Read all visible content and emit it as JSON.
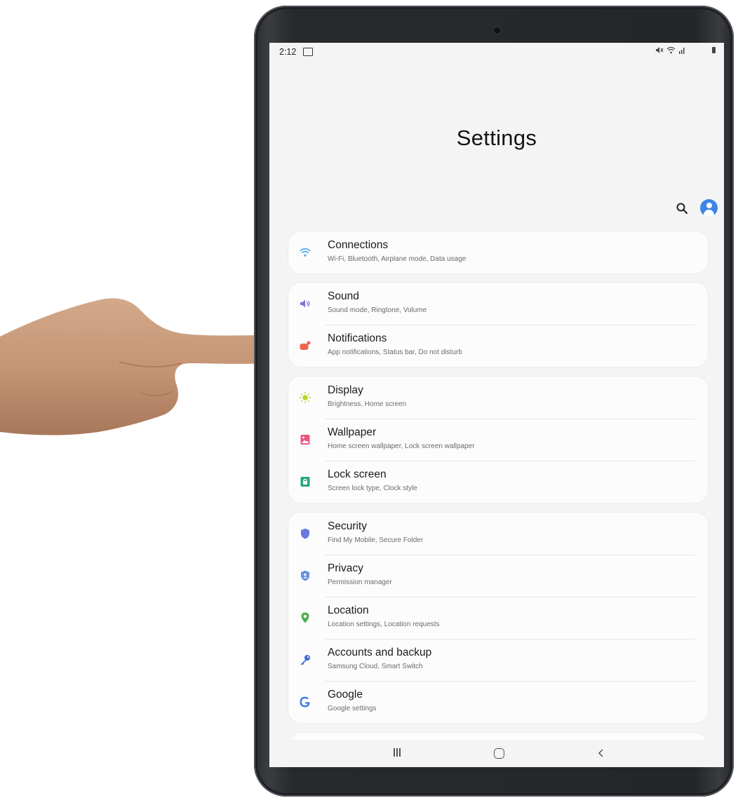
{
  "status_bar": {
    "time": "2:12",
    "image_icon": "gallery-icon"
  },
  "header": {
    "title": "Settings"
  },
  "toolbar": {
    "search_icon": "search-icon",
    "account_icon": "account-icon"
  },
  "colors": {
    "accent": "#3e84e6",
    "connections_icon": "#4aa6e8",
    "sound_icon": "#7d74d8",
    "notifications_icon": "#f2644f",
    "display_icon": "#b4d42a",
    "wallpaper_icon": "#e9577e",
    "lock_screen_icon": "#27a775",
    "security_icon": "#6a78e0",
    "privacy_icon": "#6a8fe0",
    "location_icon": "#4caf50",
    "accounts_icon": "#3a6bd4",
    "google_icon": "#3e7ae6"
  },
  "groups": [
    {
      "items": [
        {
          "label": "Connections",
          "sub": "Wi-Fi, Bluetooth, Airplane mode, Data usage",
          "icon": "wifi-icon"
        }
      ]
    },
    {
      "items": [
        {
          "label": "Sound",
          "sub": "Sound mode, Ringtone, Volume",
          "icon": "speaker-icon"
        },
        {
          "label": "Notifications",
          "sub": "App notifications, Status bar, Do not disturb",
          "icon": "notification-icon"
        }
      ]
    },
    {
      "items": [
        {
          "label": "Display",
          "sub": "Brightness, Home screen",
          "icon": "sun-icon"
        },
        {
          "label": "Wallpaper",
          "sub": "Home screen wallpaper, Lock screen wallpaper",
          "icon": "picture-icon"
        },
        {
          "label": "Lock screen",
          "sub": "Screen lock type, Clock style",
          "icon": "lock-icon"
        }
      ]
    },
    {
      "items": [
        {
          "label": "Security",
          "sub": "Find My Mobile, Secure Folder",
          "icon": "shield-icon"
        },
        {
          "label": "Privacy",
          "sub": "Permission manager",
          "icon": "privacy-shield-icon"
        },
        {
          "label": "Location",
          "sub": "Location settings, Location requests",
          "icon": "location-pin-icon"
        },
        {
          "label": "Accounts and backup",
          "sub": "Samsung Cloud, Smart Switch",
          "icon": "key-icon"
        },
        {
          "label": "Google",
          "sub": "Google settings",
          "icon": "google-icon"
        }
      ]
    }
  ],
  "nav": {
    "recent": "recent-apps-icon",
    "home": "home-icon",
    "back": "back-icon"
  }
}
